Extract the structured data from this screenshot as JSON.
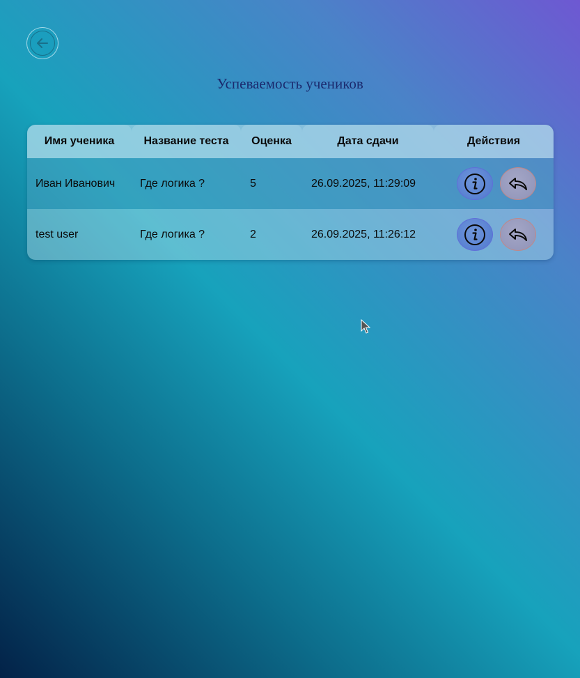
{
  "page": {
    "title": "Успеваемость учеников"
  },
  "back_button": {
    "icon": "arrow-left-circle-icon"
  },
  "table": {
    "headers": {
      "name": "Имя ученика",
      "test": "Название теста",
      "grade": "Оценка",
      "date": "Дата сдачи",
      "actions": "Действия"
    },
    "rows": [
      {
        "name": "Иван Иванович",
        "test": "Где логика ?",
        "grade": "5",
        "date": "26.09.2025, 11:29:09",
        "actions": [
          "info-icon",
          "reply-icon"
        ]
      },
      {
        "name": "test user",
        "test": "Где логика ?",
        "grade": "2",
        "date": "26.09.2025, 11:26:12",
        "actions": [
          "info-icon",
          "reply-icon"
        ]
      }
    ]
  },
  "colors": {
    "title": "#1b2a6e",
    "info_button": "#5a80d2",
    "reply_button": "#9a9dc0",
    "gradient_top_right": "#6e58d2",
    "gradient_middle": "#17a2bc",
    "gradient_bottom_left": "#032248"
  }
}
